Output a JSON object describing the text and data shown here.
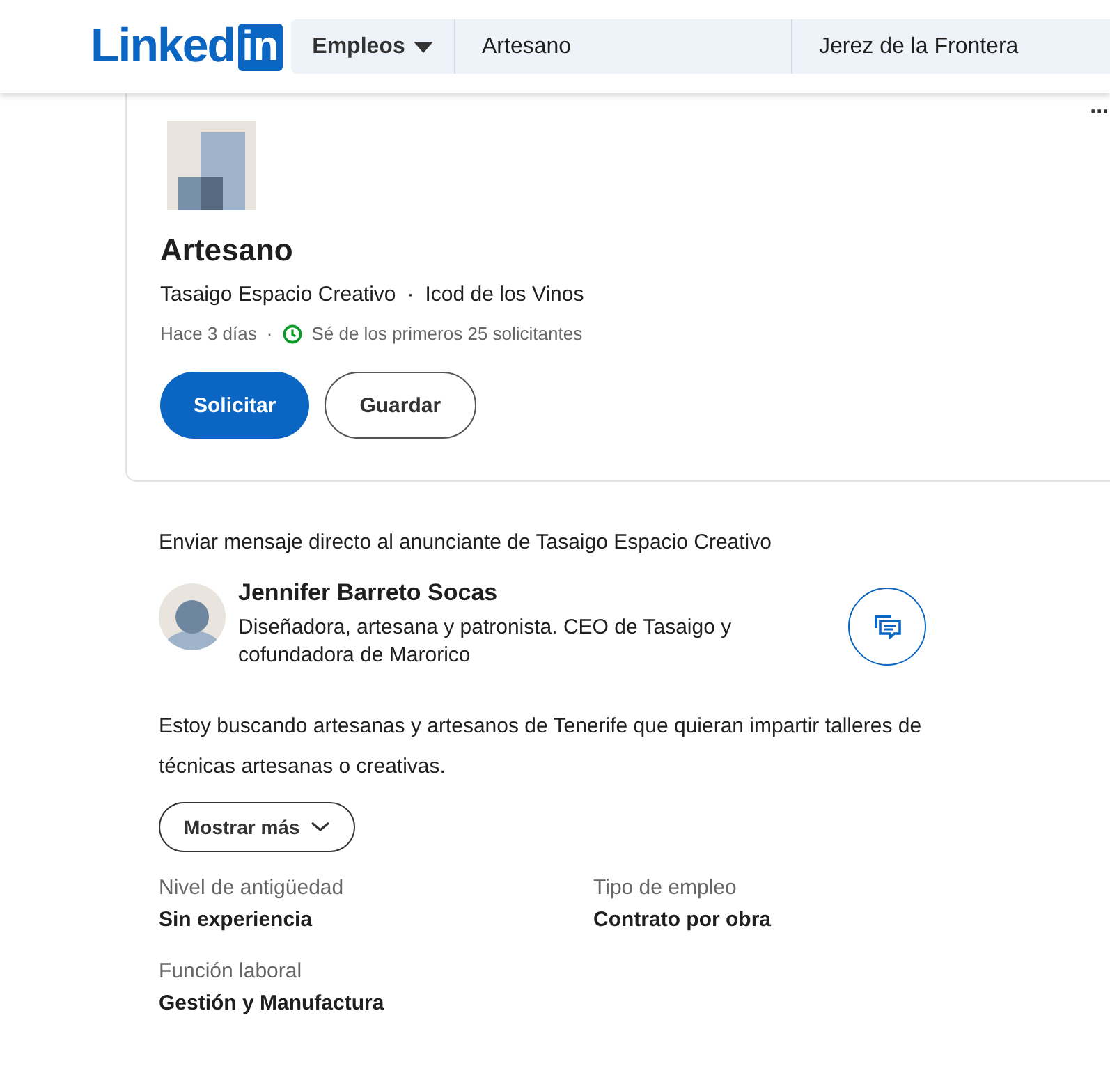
{
  "header": {
    "logo_text": "Linked",
    "logo_badge": "in",
    "search": {
      "category": "Empleos",
      "keywords": "Artesano",
      "location": "Jerez de la Frontera"
    }
  },
  "job": {
    "title": "Artesano",
    "company": "Tasaigo Espacio Creativo",
    "separator": "·",
    "location": "Icod de los Vinos",
    "posted": "Hace 3 días",
    "meta_separator": "·",
    "applicants": "Sé de los primeros 25 solicitantes",
    "more": "...",
    "apply": "Solicitar",
    "save": "Guardar"
  },
  "recruiter": {
    "heading": "Enviar mensaje directo al anunciante de Tasaigo Espacio Creativo",
    "name": "Jennifer Barreto Socas",
    "headline": "Diseñadora, artesana y patronista. CEO de Tasaigo y cofundadora de Marorico"
  },
  "description": "Estoy buscando artesanas y artesanos de Tenerife que quieran impartir talleres de técnicas artesanas o creativas.",
  "show_more": "Mostrar más",
  "criteria": [
    {
      "label": "Nivel de antigüedad",
      "value": "Sin experiencia"
    },
    {
      "label": "Tipo de empleo",
      "value": "Contrato por obra"
    },
    {
      "label": "Función laboral",
      "value": "Gestión y Manufactura"
    }
  ]
}
